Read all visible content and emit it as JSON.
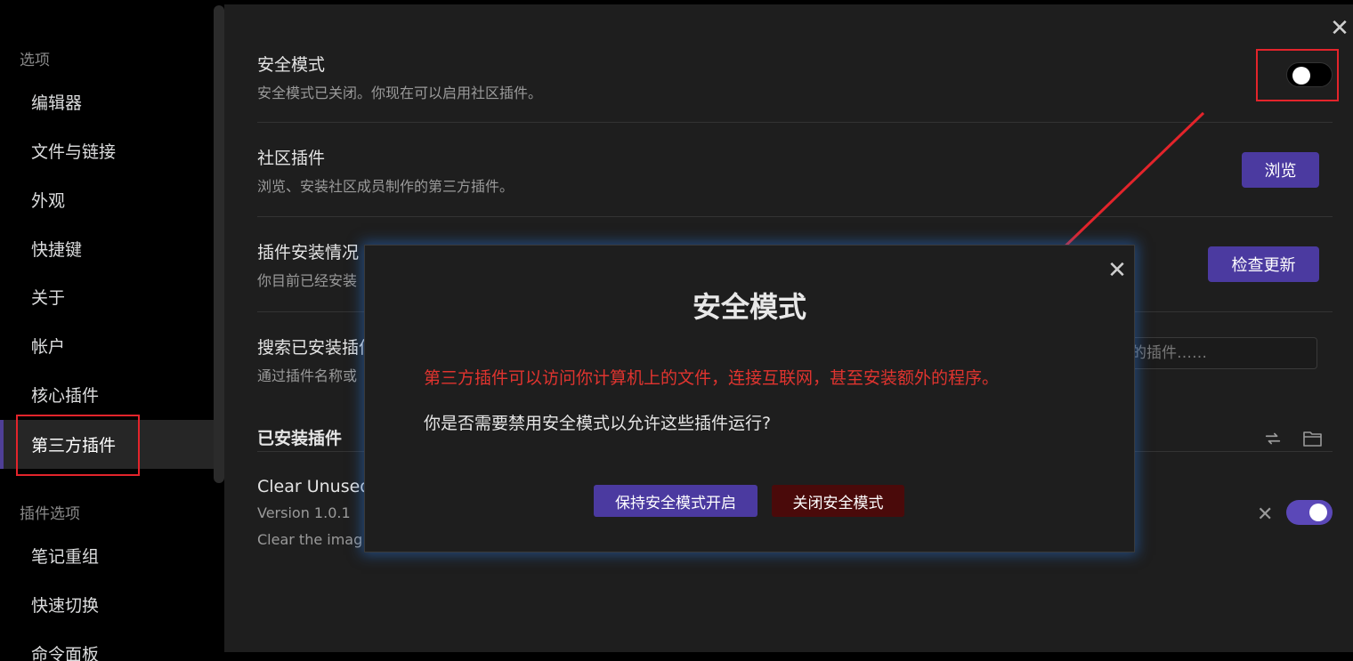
{
  "sidebar": {
    "group_options": "选项",
    "items": [
      {
        "label": "编辑器"
      },
      {
        "label": "文件与链接"
      },
      {
        "label": "外观"
      },
      {
        "label": "快捷键"
      },
      {
        "label": "关于"
      },
      {
        "label": "帐户"
      },
      {
        "label": "核心插件"
      },
      {
        "label": "第三方插件",
        "active": true
      }
    ],
    "group_plugin_options": "插件选项",
    "plugin_items": [
      {
        "label": "笔记重组"
      },
      {
        "label": "快速切换"
      },
      {
        "label": "命令面板"
      }
    ]
  },
  "settings": {
    "safe_mode": {
      "title": "安全模式",
      "desc": "安全模式已关闭。你现在可以启用社区插件。",
      "toggle_on": false
    },
    "community": {
      "title": "社区插件",
      "desc": "浏览、安装社区成员制作的第三方插件。",
      "button": "浏览"
    },
    "install_status": {
      "title": "插件安装情况",
      "desc": "你目前已经安装",
      "button": "检查更新"
    },
    "search": {
      "title": "搜索已安装插件",
      "desc": "通过插件名称或",
      "placeholder": "搜索已安装的插件……",
      "visible_placeholder": "的插件……"
    },
    "installed": {
      "header": "已安装插件",
      "reload_icon": "reload-icon",
      "folder_icon": "folder-icon"
    },
    "plugin": {
      "name": "Clear Unused",
      "version": "Version 1.0.1",
      "desc": "Clear the imag",
      "enabled": true
    }
  },
  "modal": {
    "title": "安全模式",
    "warning": "第三方插件可以访问你计算机上的文件，连接互联网，甚至安装额外的程序。",
    "question": "你是否需要禁用安全模式以允许这些插件运行?",
    "keep_button": "保持安全模式开启",
    "disable_button": "关闭安全模式"
  },
  "colors": {
    "accent": "#4b3aa0",
    "danger_button": "#4a0a0a",
    "warning_text": "#e0342f",
    "annotation": "#e3242b"
  }
}
